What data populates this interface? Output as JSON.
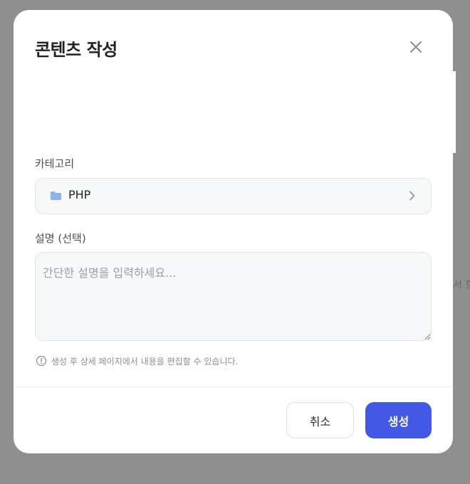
{
  "background": {
    "partial_text": "서 힝"
  },
  "modal": {
    "title": "콘텐츠 작성",
    "close_icon": "close-icon",
    "category": {
      "label": "카테고리",
      "value": "PHP",
      "icon": "folder-icon",
      "chevron_icon": "chevron-right-icon"
    },
    "description": {
      "label": "설명 (선택)",
      "placeholder": "간단한 설명을 입력하세요...",
      "value": ""
    },
    "hint": {
      "icon": "info-icon",
      "text": "생성 후 상세 페이지에서 내용을 편집할 수 있습니다."
    },
    "buttons": {
      "cancel": "취소",
      "create": "생성"
    }
  },
  "colors": {
    "accent": "#4359e6",
    "overlay": "#8f8f8f",
    "folder": "#8ab4f0"
  }
}
